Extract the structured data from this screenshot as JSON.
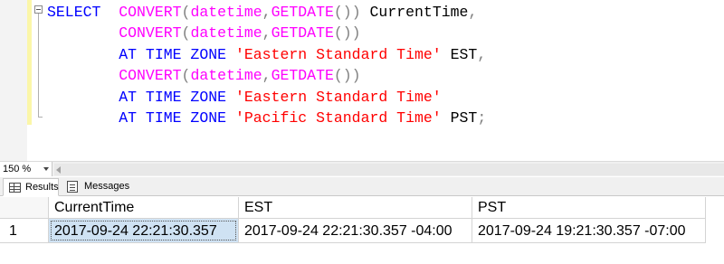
{
  "editor": {
    "lines": [
      [
        {
          "t": "SELECT",
          "c": "kw"
        },
        {
          "t": "  ",
          "c": "tx"
        },
        {
          "t": "CONVERT",
          "c": "fn"
        },
        {
          "t": "(",
          "c": "gy"
        },
        {
          "t": "datetime",
          "c": "fn"
        },
        {
          "t": ",",
          "c": "gy"
        },
        {
          "t": "GETDATE",
          "c": "fn"
        },
        {
          "t": "())",
          "c": "gy"
        },
        {
          "t": " CurrentTime",
          "c": "tx"
        },
        {
          "t": ",",
          "c": "gy"
        }
      ],
      [
        {
          "t": "        ",
          "c": "tx"
        },
        {
          "t": "CONVERT",
          "c": "fn"
        },
        {
          "t": "(",
          "c": "gy"
        },
        {
          "t": "datetime",
          "c": "fn"
        },
        {
          "t": ",",
          "c": "gy"
        },
        {
          "t": "GETDATE",
          "c": "fn"
        },
        {
          "t": "())",
          "c": "gy"
        }
      ],
      [
        {
          "t": "        ",
          "c": "tx"
        },
        {
          "t": "AT TIME ZONE",
          "c": "kw"
        },
        {
          "t": " ",
          "c": "tx"
        },
        {
          "t": "'Eastern Standard Time'",
          "c": "st"
        },
        {
          "t": " EST",
          "c": "tx"
        },
        {
          "t": ",",
          "c": "gy"
        }
      ],
      [
        {
          "t": "        ",
          "c": "tx"
        },
        {
          "t": "CONVERT",
          "c": "fn"
        },
        {
          "t": "(",
          "c": "gy"
        },
        {
          "t": "datetime",
          "c": "fn"
        },
        {
          "t": ",",
          "c": "gy"
        },
        {
          "t": "GETDATE",
          "c": "fn"
        },
        {
          "t": "())",
          "c": "gy"
        }
      ],
      [
        {
          "t": "        ",
          "c": "tx"
        },
        {
          "t": "AT TIME ZONE",
          "c": "kw"
        },
        {
          "t": " ",
          "c": "tx"
        },
        {
          "t": "'Eastern Standard Time'",
          "c": "st"
        }
      ],
      [
        {
          "t": "        ",
          "c": "tx"
        },
        {
          "t": "AT TIME ZONE",
          "c": "kw"
        },
        {
          "t": " ",
          "c": "tx"
        },
        {
          "t": "'Pacific Standard Time'",
          "c": "st"
        },
        {
          "t": " PST",
          "c": "tx"
        },
        {
          "t": ";",
          "c": "gy"
        }
      ]
    ],
    "colors": {
      "keyword": "#0000ff",
      "function": "#ff00ff",
      "operator": "#808080",
      "string": "#ff0000",
      "text": "#000000"
    }
  },
  "zoom": {
    "value": "150 %",
    "caret_icon": "chevron-down-icon"
  },
  "tabs": {
    "results": {
      "label": "Results",
      "icon": "grid-icon"
    },
    "messages": {
      "label": "Messages",
      "icon": "messages-icon"
    }
  },
  "results": {
    "columns": [
      "",
      "CurrentTime",
      "EST",
      "PST"
    ],
    "rows": [
      [
        "1",
        "2017-09-24 22:21:30.357",
        "2017-09-24 22:21:30.357 -04:00",
        "2017-09-24 19:21:30.357 -07:00"
      ]
    ],
    "selected_color": "#cfe2f3"
  }
}
